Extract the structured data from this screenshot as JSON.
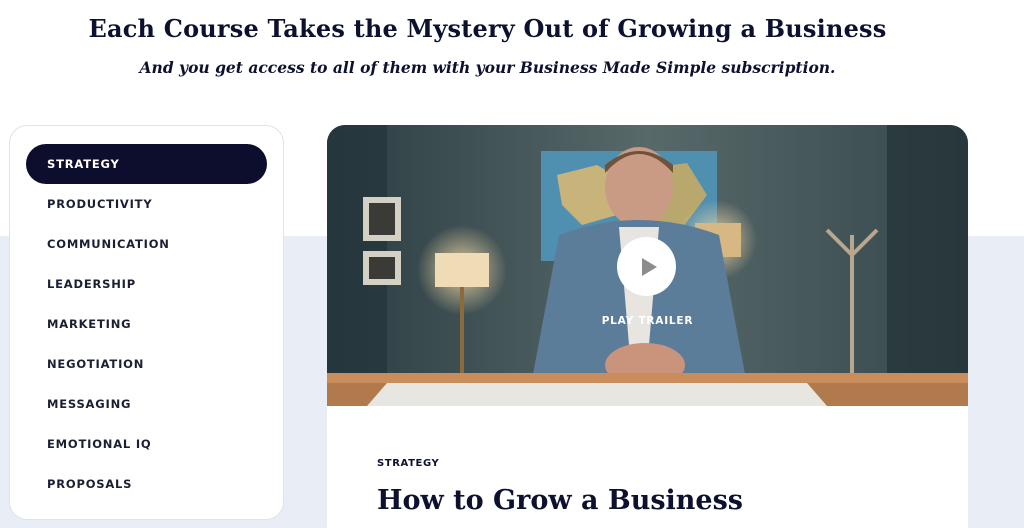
{
  "header": {
    "headline": "Each Course Takes the Mystery Out of Growing a Business",
    "subline": "And you get access to all of them with your Business Made Simple subscription."
  },
  "menu": {
    "active_index": 0,
    "items": [
      {
        "label": "STRATEGY"
      },
      {
        "label": "PRODUCTIVITY"
      },
      {
        "label": "COMMUNICATION"
      },
      {
        "label": "LEADERSHIP"
      },
      {
        "label": "MARKETING"
      },
      {
        "label": "NEGOTIATION"
      },
      {
        "label": "MESSAGING"
      },
      {
        "label": "EMOTIONAL IQ"
      },
      {
        "label": "PROPOSALS"
      }
    ]
  },
  "course": {
    "category": "STRATEGY",
    "title": "How to Grow a Business",
    "play_label": "PLAY TRAILER",
    "play_icon": "play-icon"
  },
  "colors": {
    "navy": "#0d0d2e",
    "band": "#e9edf5"
  }
}
